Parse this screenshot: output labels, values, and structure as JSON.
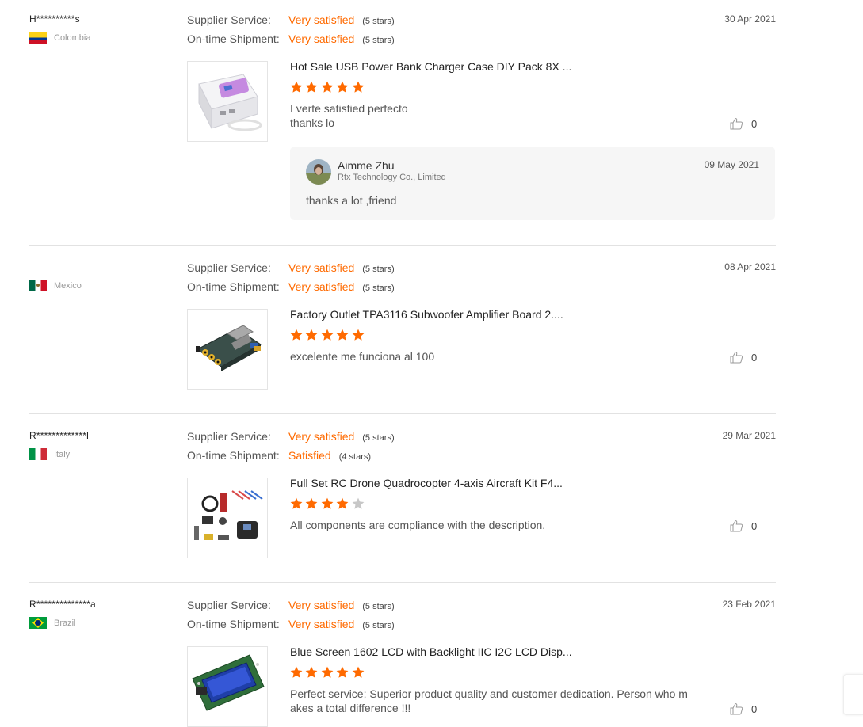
{
  "colors": {
    "accent": "#ff6a00",
    "star_filled": "#ff6a00",
    "star_empty": "#c7c7c7"
  },
  "reviews": [
    {
      "buyer": "H**********s",
      "country": "Colombia",
      "date": "30 Apr 2021",
      "supplier_service": {
        "label": "Supplier Service:",
        "value": "Very satisfied",
        "stars": "(5 stars)"
      },
      "shipment": {
        "label": "On-time Shipment:",
        "value": "Very satisfied",
        "stars": "(5 stars)"
      },
      "product_title": "Hot Sale USB Power Bank Charger Case DIY Pack 8X ...",
      "rating": 5,
      "text_line1": "I verte satisfied perfecto",
      "text_line2": "thanks lo",
      "likes": "0",
      "reply": {
        "name": "Aimme Zhu",
        "company": "Rtx Technology Co., Limited",
        "date": "09 May 2021",
        "text": "thanks a lot ,friend"
      }
    },
    {
      "buyer": "",
      "country": "Mexico",
      "date": "08 Apr 2021",
      "supplier_service": {
        "label": "Supplier Service:",
        "value": "Very satisfied",
        "stars": "(5 stars)"
      },
      "shipment": {
        "label": "On-time Shipment:",
        "value": "Very satisfied",
        "stars": "(5 stars)"
      },
      "product_title": "Factory Outlet TPA3116 Subwoofer Amplifier Board 2....",
      "rating": 5,
      "text_line1": "excelente me funciona al 100",
      "likes": "0"
    },
    {
      "buyer": "R*************l",
      "country": "Italy",
      "date": "29 Mar 2021",
      "supplier_service": {
        "label": "Supplier Service:",
        "value": "Very satisfied",
        "stars": "(5 stars)"
      },
      "shipment": {
        "label": "On-time Shipment:",
        "value": "Satisfied",
        "stars": "(4 stars)"
      },
      "product_title": "Full Set RC Drone Quadrocopter 4-axis Aircraft Kit F4...",
      "rating": 4,
      "text_line1": "All components are compliance with the description.",
      "likes": "0"
    },
    {
      "buyer": "R**************a",
      "country": "Brazil",
      "date": "23 Feb 2021",
      "supplier_service": {
        "label": "Supplier Service:",
        "value": "Very satisfied",
        "stars": "(5 stars)"
      },
      "shipment": {
        "label": "On-time Shipment:",
        "value": "Very satisfied",
        "stars": "(5 stars)"
      },
      "product_title": "Blue Screen 1602 LCD with Backlight IIC I2C LCD Disp...",
      "rating": 5,
      "text_line1": "Perfect service; Superior product quality and customer dedication. Person who m",
      "text_line2": "akes a total difference !!!",
      "likes": "0"
    }
  ]
}
